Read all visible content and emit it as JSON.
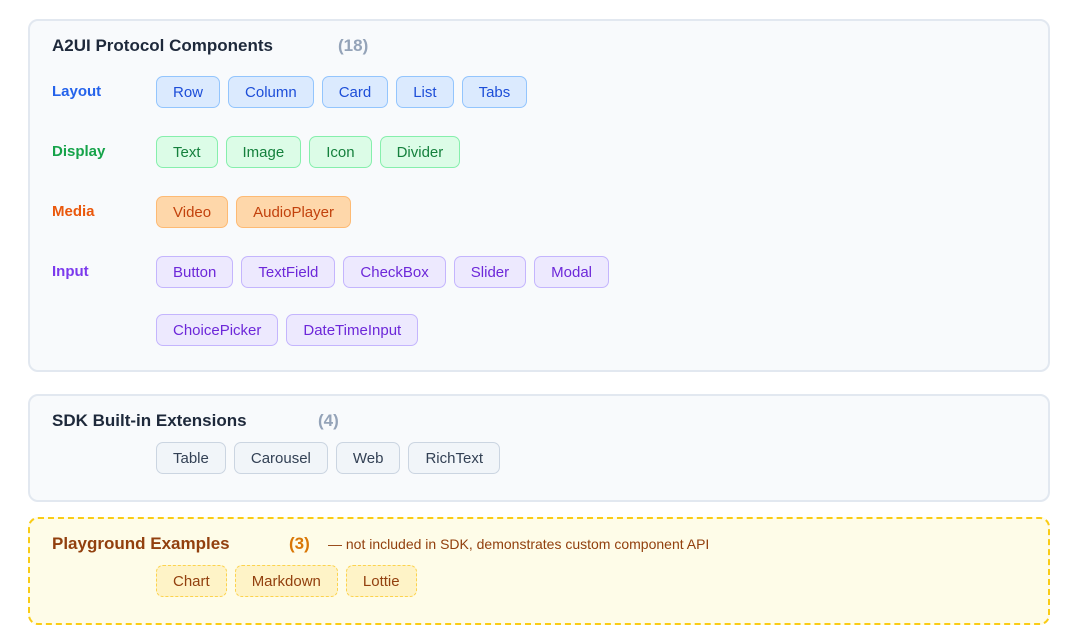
{
  "protocol": {
    "title": "A2UI Protocol Components",
    "count": "(18)",
    "categories": [
      {
        "label": "Layout",
        "color": "#2563eb",
        "items": [
          "Row",
          "Column",
          "Card",
          "List",
          "Tabs"
        ]
      },
      {
        "label": "Display",
        "color": "#16a34a",
        "items": [
          "Text",
          "Image",
          "Icon",
          "Divider"
        ]
      },
      {
        "label": "Media",
        "color": "#ea580c",
        "items": [
          "Video",
          "AudioPlayer"
        ]
      },
      {
        "label": "Input",
        "color": "#7c3aed",
        "items": [
          "Button",
          "TextField",
          "CheckBox",
          "Slider",
          "Modal",
          "ChoicePicker",
          "DateTimeInput"
        ]
      }
    ]
  },
  "sdk": {
    "title": "SDK Built-in Extensions",
    "count": "(4)",
    "items": [
      "Table",
      "Carousel",
      "Web",
      "RichText"
    ]
  },
  "playground": {
    "title": "Playground Examples",
    "count": "(3)",
    "note": "— not included in SDK, demonstrates custom component API",
    "items": [
      "Chart",
      "Markdown",
      "Lottie"
    ]
  },
  "colors": {
    "title": "#1e293b",
    "count_gray": "#94a3b8",
    "playground_title": "#92400e",
    "playground_count": "#d97706",
    "panel_border": "#e2e8f0",
    "playground_border": "#facc15"
  }
}
